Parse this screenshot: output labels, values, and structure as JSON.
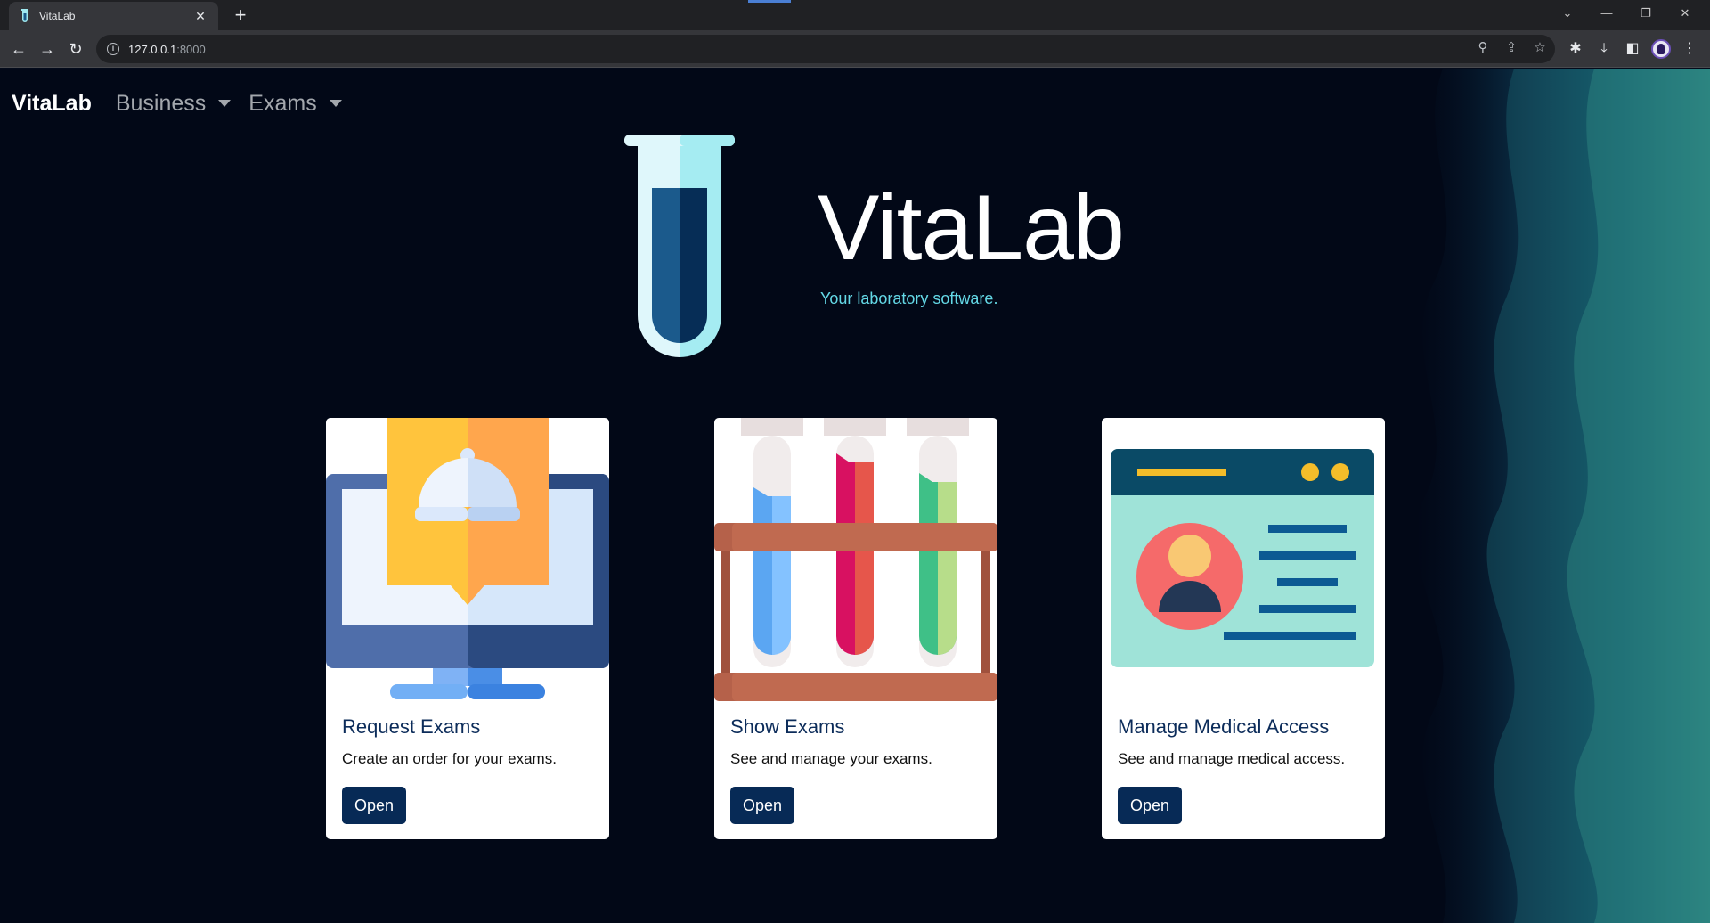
{
  "browser": {
    "tab_title": "VitaLab",
    "url_host": "127.0.0.1",
    "url_port": ":8000"
  },
  "navbar": {
    "brand": "VitaLab",
    "items": [
      {
        "label": "Business"
      },
      {
        "label": "Exams"
      }
    ]
  },
  "hero": {
    "title": "VitaLab",
    "subtitle": "Your laboratory software."
  },
  "cards": [
    {
      "title": "Request Exams",
      "text": "Create an order for your exams.",
      "button": "Open",
      "icon": "monitor-bell-icon"
    },
    {
      "title": "Show Exams",
      "text": "See and manage your exams.",
      "button": "Open",
      "icon": "test-tubes-rack-icon"
    },
    {
      "title": "Manage Medical Access",
      "text": "See and manage medical access.",
      "button": "Open",
      "icon": "profile-window-icon"
    }
  ],
  "colors": {
    "page_bg": "#020817",
    "accent_subtitle": "#64d8e6",
    "card_title": "#0c2c5a",
    "button_bg": "#072a56"
  }
}
